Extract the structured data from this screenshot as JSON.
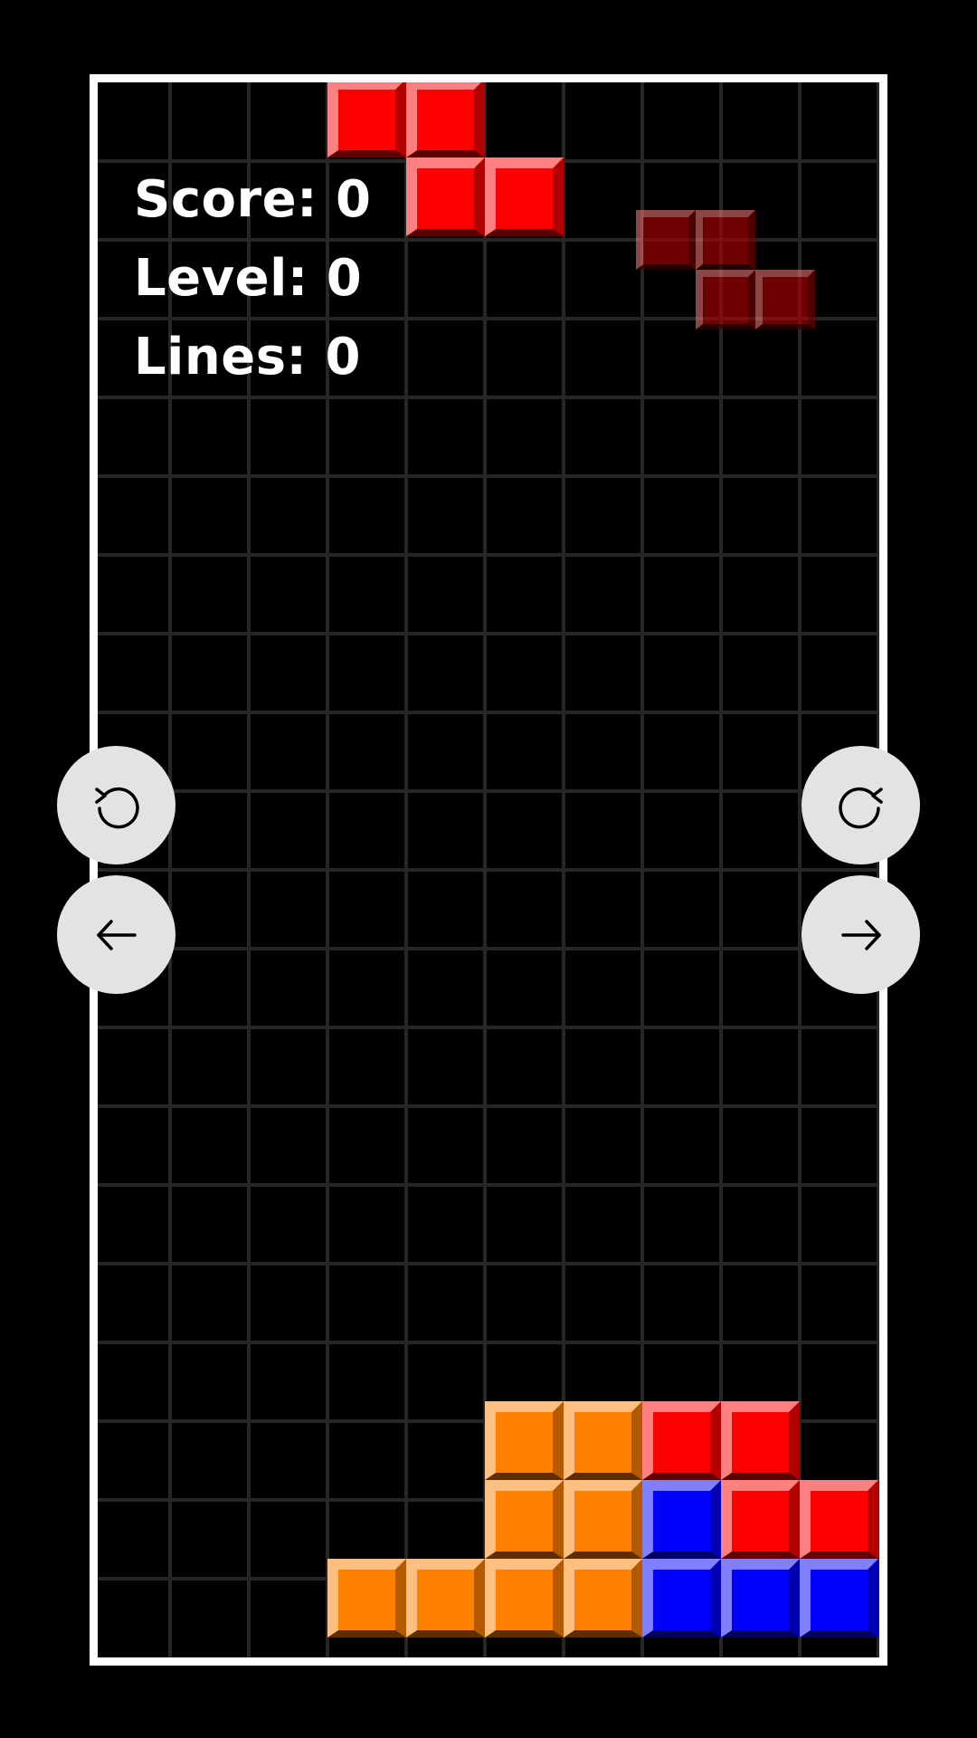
{
  "hud": {
    "score_text": "Score: 0",
    "level_text": "Level: 0",
    "lines_text": "Lines: 0"
  },
  "board": {
    "columns": 10,
    "rows": 20,
    "colors": {
      "red": {
        "base": "#ff0000",
        "hi": "#ff8080",
        "sh": "#b30000",
        "dk": "#5e0000"
      },
      "orange": {
        "base": "#ff8000",
        "hi": "#ffbf80",
        "sh": "#b35900",
        "dk": "#5e2e00"
      },
      "blue": {
        "base": "#0000ff",
        "hi": "#8080ff",
        "sh": "#0000b3",
        "dk": "#00005e"
      },
      "ghost": {
        "base": "#b00000",
        "hi": "#e07070",
        "sh": "#7a0000",
        "dk": "#3a0000"
      }
    },
    "active_piece": {
      "type": "Z",
      "color": "red",
      "cells": [
        [
          3,
          0
        ],
        [
          4,
          0
        ],
        [
          4,
          1
        ],
        [
          5,
          1
        ]
      ]
    },
    "next_piece_preview": {
      "type": "Z",
      "color": "ghost"
    },
    "stack": [
      {
        "col": 5,
        "row": 17,
        "color": "orange"
      },
      {
        "col": 6,
        "row": 17,
        "color": "orange"
      },
      {
        "col": 7,
        "row": 17,
        "color": "red"
      },
      {
        "col": 8,
        "row": 17,
        "color": "red"
      },
      {
        "col": 5,
        "row": 18,
        "color": "orange"
      },
      {
        "col": 6,
        "row": 18,
        "color": "orange"
      },
      {
        "col": 7,
        "row": 18,
        "color": "blue"
      },
      {
        "col": 8,
        "row": 18,
        "color": "red"
      },
      {
        "col": 9,
        "row": 18,
        "color": "red"
      },
      {
        "col": 3,
        "row": 19,
        "color": "orange"
      },
      {
        "col": 4,
        "row": 19,
        "color": "orange"
      },
      {
        "col": 5,
        "row": 19,
        "color": "orange"
      },
      {
        "col": 6,
        "row": 19,
        "color": "orange"
      },
      {
        "col": 7,
        "row": 19,
        "color": "blue"
      },
      {
        "col": 8,
        "row": 19,
        "color": "blue"
      },
      {
        "col": 9,
        "row": 19,
        "color": "blue"
      }
    ]
  },
  "controls": {
    "rotate_left": "rotate-ccw-icon",
    "rotate_right": "rotate-cw-icon",
    "move_left": "arrow-left-icon",
    "move_right": "arrow-right-icon"
  }
}
